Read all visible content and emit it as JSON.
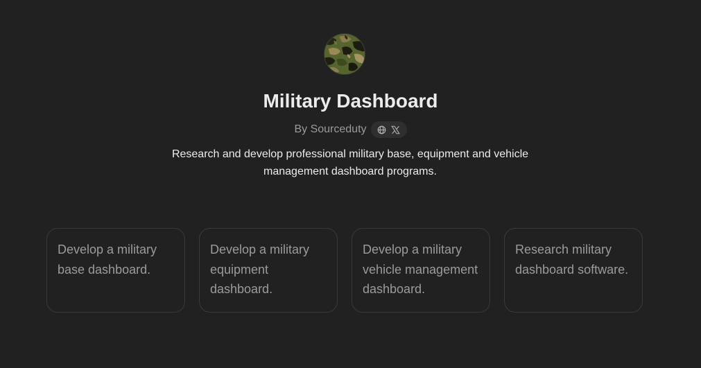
{
  "gpt": {
    "avatar_icon": "camouflage-avatar-icon",
    "title": "Military Dashboard",
    "byline": "By Sourceduty",
    "social_icons": [
      "globe-icon",
      "x-logo-icon"
    ],
    "description": "Research and develop professional military base, equipment and vehicle management dashboard programs."
  },
  "starters": [
    {
      "label": "Develop a military base dashboard."
    },
    {
      "label": "Develop a military equipment dashboard."
    },
    {
      "label": "Develop a military vehicle management dashboard."
    },
    {
      "label": "Research military dashboard software."
    }
  ],
  "colors": {
    "background": "#212121",
    "text": "#ececec",
    "muted": "#9b9b9b",
    "card_border": "#3a3a3a",
    "pill_background": "#2f2f2f"
  }
}
